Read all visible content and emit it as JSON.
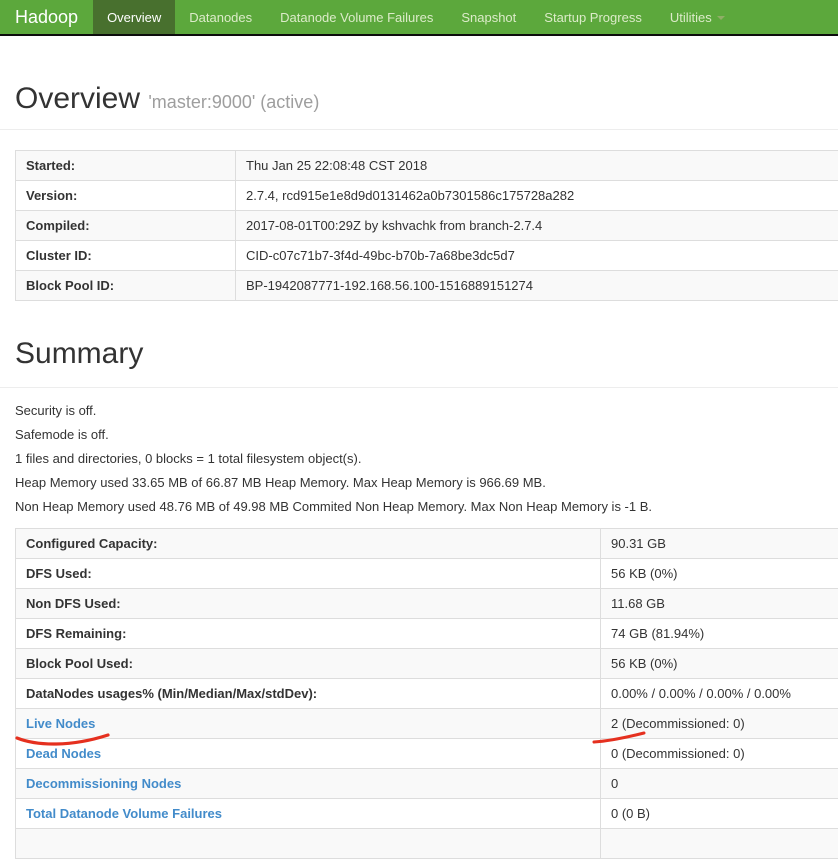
{
  "navbar": {
    "brand": "Hadoop",
    "items": [
      {
        "label": "Overview",
        "active": true
      },
      {
        "label": "Datanodes",
        "active": false
      },
      {
        "label": "Datanode Volume Failures",
        "active": false
      },
      {
        "label": "Snapshot",
        "active": false
      },
      {
        "label": "Startup Progress",
        "active": false
      },
      {
        "label": "Utilities",
        "active": false,
        "has_caret": true
      }
    ]
  },
  "overview": {
    "title": "Overview",
    "subtitle": "'master:9000' (active)",
    "info_table": {
      "rows": [
        {
          "label": "Started:",
          "value": "Thu Jan 25 22:08:48 CST 2018"
        },
        {
          "label": "Version:",
          "value": "2.7.4, rcd915e1e8d9d0131462a0b7301586c175728a282"
        },
        {
          "label": "Compiled:",
          "value": "2017-08-01T00:29Z by kshvachk from branch-2.7.4"
        },
        {
          "label": "Cluster ID:",
          "value": "CID-c07c71b7-3f4d-49bc-b70b-7a68be3dc5d7"
        },
        {
          "label": "Block Pool ID:",
          "value": "BP-1942087771-192.168.56.100-1516889151274"
        }
      ]
    }
  },
  "summary": {
    "title": "Summary",
    "paragraphs": [
      "Security is off.",
      "Safemode is off.",
      "1 files and directories, 0 blocks = 1 total filesystem object(s).",
      "Heap Memory used 33.65 MB of 66.87 MB Heap Memory. Max Heap Memory is 966.69 MB.",
      "Non Heap Memory used 48.76 MB of 49.98 MB Commited Non Heap Memory. Max Non Heap Memory is -1 B."
    ],
    "table": {
      "rows": [
        {
          "label": "Configured Capacity:",
          "value": "90.31 GB",
          "is_link": false
        },
        {
          "label": "DFS Used:",
          "value": "56 KB (0%)",
          "is_link": false
        },
        {
          "label": "Non DFS Used:",
          "value": "11.68 GB",
          "is_link": false
        },
        {
          "label": "DFS Remaining:",
          "value": "74 GB (81.94%)",
          "is_link": false
        },
        {
          "label": "Block Pool Used:",
          "value": "56 KB (0%)",
          "is_link": false
        },
        {
          "label": "DataNodes usages% (Min/Median/Max/stdDev):",
          "value": "0.00% / 0.00% / 0.00% / 0.00%",
          "is_link": false
        },
        {
          "label": "Live Nodes",
          "value": "2 (Decommissioned: 0)",
          "is_link": true
        },
        {
          "label": "Dead Nodes",
          "value": "0 (Decommissioned: 0)",
          "is_link": true
        },
        {
          "label": "Decommissioning Nodes",
          "value": "0",
          "is_link": true
        },
        {
          "label": "Total Datanode Volume Failures",
          "value": "0 (0 B)",
          "is_link": true
        }
      ]
    }
  },
  "annotations": {
    "description": "hand-drawn red underline marks on the Live Nodes row",
    "color": "#e5301f"
  },
  "colors": {
    "navbar_bg": "#5CA83C",
    "navbar_active_bg": "#48702E",
    "navbar_text": "#dcebc9",
    "link": "#428bca",
    "text": "#333333",
    "muted": "#9e9e9e",
    "table_border": "#dddddd",
    "stripe": "#f9f9f9"
  }
}
